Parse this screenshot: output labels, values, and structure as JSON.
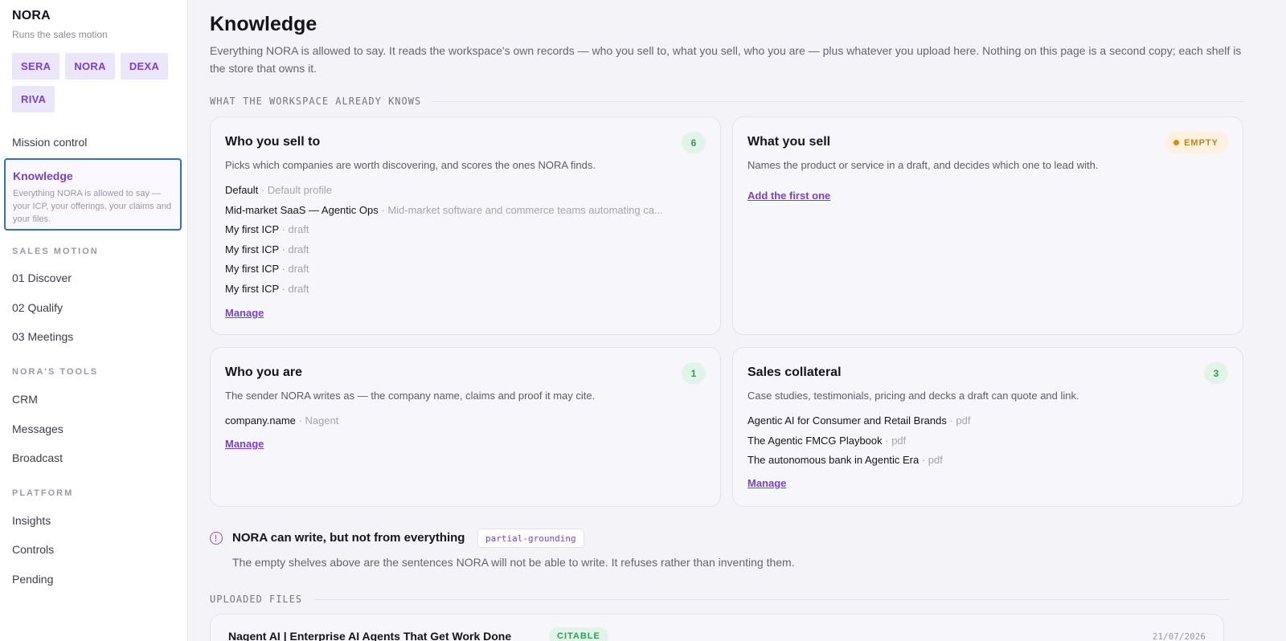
{
  "sidebar": {
    "brand": "NORA",
    "brand_sub": "Runs the sales motion",
    "agents": [
      "SERA",
      "NORA",
      "DEXA",
      "RIVA"
    ],
    "mission_control": "Mission control",
    "knowledge": {
      "title": "Knowledge",
      "desc": "Everything NORA is allowed to say — your ICP, your offerings, your claims and your files."
    },
    "sections": {
      "sales_motion": "SALES MOTION",
      "noras_tools": "NORA'S TOOLS",
      "platform": "PLATFORM"
    },
    "sales_motion_items": [
      "01 Discover",
      "02 Qualify",
      "03 Meetings"
    ],
    "tools_items": [
      "CRM",
      "Messages",
      "Broadcast"
    ],
    "platform_items": [
      "Insights",
      "Controls",
      "Pending"
    ]
  },
  "main": {
    "title": "Knowledge",
    "intro": "Everything NORA is allowed to say. It reads the workspace's own records — who you sell to, what you sell, who you are — plus whatever you upload here. Nothing on this page is a second copy; each shelf is the store that owns it.",
    "section_known": "WHAT THE WORKSPACE ALREADY KNOWS",
    "section_files": "UPLOADED FILES",
    "cards": {
      "sell_to": {
        "title": "Who you sell to",
        "count": "6",
        "desc": "Picks which companies are worth discovering, and scores the ones NORA finds.",
        "items": [
          {
            "name": "Default",
            "meta": "Default profile"
          },
          {
            "name": "Mid-market SaaS — Agentic Ops",
            "meta": "Mid-market software and commerce teams automating ca..."
          },
          {
            "name": "My first ICP",
            "meta": "draft"
          },
          {
            "name": "My first ICP",
            "meta": "draft"
          },
          {
            "name": "My first ICP",
            "meta": "draft"
          },
          {
            "name": "My first ICP",
            "meta": "draft"
          }
        ],
        "link": "Manage"
      },
      "what_sell": {
        "title": "What you sell",
        "badge": "EMPTY",
        "desc": "Names the product or service in a draft, and decides which one to lead with.",
        "link": "Add the first one"
      },
      "who_are": {
        "title": "Who you are",
        "count": "1",
        "desc": "The sender NORA writes as — the company name, claims and proof it may cite.",
        "items": [
          {
            "name": "company.name",
            "meta": "Nagent"
          }
        ],
        "link": "Manage"
      },
      "collateral": {
        "title": "Sales collateral",
        "count": "3",
        "desc": "Case studies, testimonials, pricing and decks a draft can quote and link.",
        "items": [
          {
            "name": "Agentic AI for Consumer and Retail Brands",
            "meta": "pdf"
          },
          {
            "name": "The Agentic FMCG Playbook",
            "meta": "pdf"
          },
          {
            "name": "The autonomous bank in Agentic Era",
            "meta": "pdf"
          }
        ],
        "link": "Manage"
      }
    },
    "notice": {
      "title": "NORA can write, but not from everything",
      "tag": "partial-grounding",
      "body": "The empty shelves above are the sentences NORA will not be able to write. It refuses rather than inventing them."
    },
    "file": {
      "title": "Nagent AI | Enterprise AI Agents That Get Work Done",
      "badge": "CITABLE",
      "date": "21/07/2026"
    }
  },
  "colors": {
    "accent": "#7a3fd0",
    "focus_border": "#2d6fc9",
    "count_badge_bg": "#e2f4ea",
    "count_badge_text": "#2f9a5b",
    "empty_badge_bg": "#fdf1df",
    "empty_badge_text": "#c7811b"
  }
}
